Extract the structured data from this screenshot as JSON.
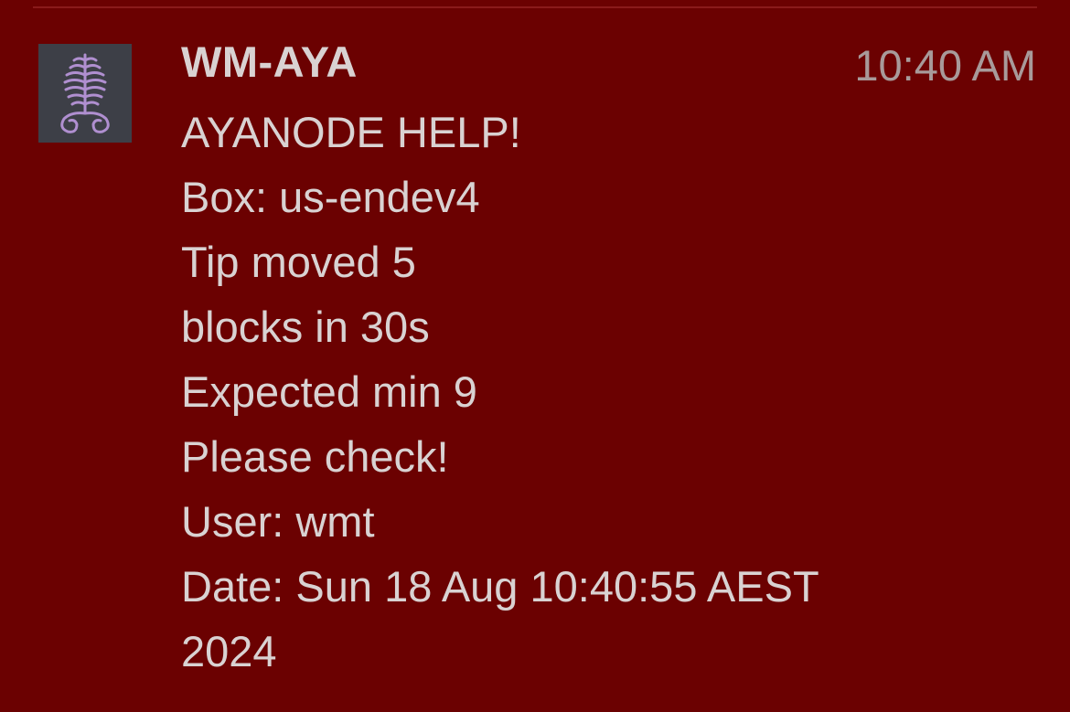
{
  "notification": {
    "sender": "WM-AYA",
    "time": "10:40 AM",
    "avatar_icon": "fern-logo-icon",
    "message_lines": [
      "AYANODE HELP!",
      "Box: us-endev4",
      "Tip moved 5",
      "blocks in 30s",
      "Expected min 9",
      "Please check!",
      "User: wmt",
      "Date: Sun 18 Aug 10:40:55 AEST",
      "2024"
    ]
  },
  "colors": {
    "background": "#6b0101",
    "text": "#d9d2d2",
    "time_text": "#a89a9a",
    "avatar_bg": "#3d3f47",
    "avatar_icon": "#b08fd0"
  }
}
